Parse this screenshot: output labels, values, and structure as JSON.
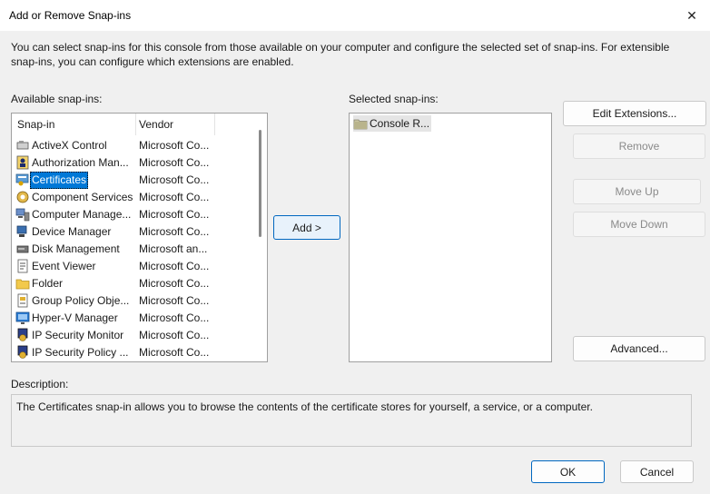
{
  "window": {
    "title": "Add or Remove Snap-ins",
    "close_glyph": "✕"
  },
  "intro": "You can select snap-ins for this console from those available on your computer and configure the selected set of snap-ins. For extensible snap-ins, you can configure which extensions are enabled.",
  "available": {
    "label": "Available snap-ins:",
    "columns": [
      "Snap-in",
      "Vendor"
    ],
    "items": [
      {
        "name": "ActiveX Control",
        "vendor": "Microsoft Co...",
        "icon": "activex-icon"
      },
      {
        "name": "Authorization Man...",
        "vendor": "Microsoft Co...",
        "icon": "authorization-manager-icon"
      },
      {
        "name": "Certificates",
        "vendor": "Microsoft Co...",
        "icon": "certificates-icon"
      },
      {
        "name": "Component Services",
        "vendor": "Microsoft Co...",
        "icon": "component-services-icon"
      },
      {
        "name": "Computer Manage...",
        "vendor": "Microsoft Co...",
        "icon": "computer-management-icon"
      },
      {
        "name": "Device Manager",
        "vendor": "Microsoft Co...",
        "icon": "device-manager-icon"
      },
      {
        "name": "Disk Management",
        "vendor": "Microsoft an...",
        "icon": "disk-management-icon"
      },
      {
        "name": "Event Viewer",
        "vendor": "Microsoft Co...",
        "icon": "event-viewer-icon"
      },
      {
        "name": "Folder",
        "vendor": "Microsoft Co...",
        "icon": "folder-icon"
      },
      {
        "name": "Group Policy Obje...",
        "vendor": "Microsoft Co...",
        "icon": "group-policy-icon"
      },
      {
        "name": "Hyper-V Manager",
        "vendor": "Microsoft Co...",
        "icon": "hyper-v-icon"
      },
      {
        "name": "IP Security Monitor",
        "vendor": "Microsoft Co...",
        "icon": "ip-security-monitor-icon"
      },
      {
        "name": "IP Security Policy ...",
        "vendor": "Microsoft Co...",
        "icon": "ip-security-policy-icon"
      }
    ],
    "selected_index": 2
  },
  "buttons": {
    "add": "Add >",
    "edit_extensions": "Edit Extensions...",
    "remove": "Remove",
    "move_up": "Move Up",
    "move_down": "Move Down",
    "advanced": "Advanced...",
    "ok": "OK",
    "cancel": "Cancel"
  },
  "selected": {
    "label": "Selected snap-ins:",
    "items": [
      {
        "name": "Console R...",
        "icon": "console-root-folder-icon"
      }
    ]
  },
  "description": {
    "label": "Description:",
    "text": "The Certificates snap-in allows you to browse the contents of the certificate stores for yourself, a service, or a computer."
  },
  "colors": {
    "selection": "#0078d7",
    "accent_border": "#0067c0"
  }
}
